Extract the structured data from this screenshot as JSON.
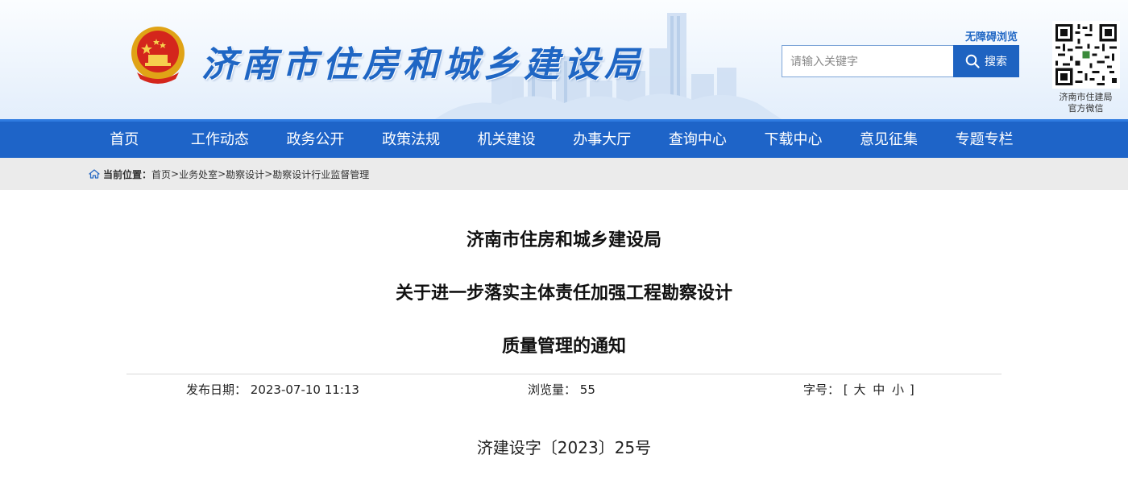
{
  "header": {
    "site_title": "济南市住房和城乡建设局",
    "accessible_link": "无障碍浏览",
    "search_placeholder": "请输入关键字",
    "search_button": "搜索",
    "qr_caption_line1": "济南市住建局",
    "qr_caption_line2": "官方微信"
  },
  "nav": {
    "items": [
      "首页",
      "工作动态",
      "政务公开",
      "政策法规",
      "机关建设",
      "办事大厅",
      "查询中心",
      "下载中心",
      "意见征集",
      "专题专栏"
    ]
  },
  "breadcrumb": {
    "label": "当前位置：",
    "items": [
      "首页",
      "业务处室",
      "勘察设计",
      "勘察设计行业监督管理"
    ],
    "separator": ">"
  },
  "article": {
    "title_lines": [
      "济南市住房和城乡建设局",
      "关于进一步落实主体责任加强工程勘察设计",
      "质量管理的通知"
    ],
    "publish_label": "发布日期：",
    "publish_date": "2023-07-10 11:13",
    "views_label": "浏览量：",
    "views_count": "55",
    "font_label": "字号：",
    "font_open": "[",
    "font_large": "大",
    "font_medium": "中",
    "font_small": "小",
    "font_close": "]",
    "doc_number": "济建设字〔2023〕25号"
  },
  "colors": {
    "brand_blue": "#1e64c8",
    "title_blue": "#1f66c4",
    "crumb_bg": "#ebebeb"
  }
}
